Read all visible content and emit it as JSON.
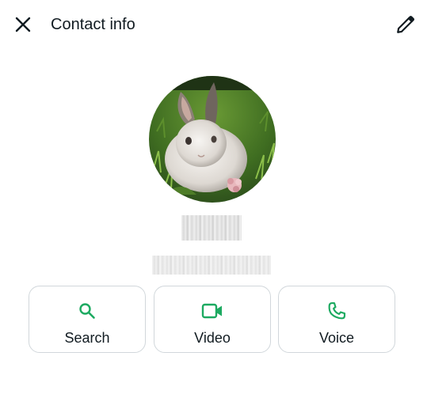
{
  "header": {
    "title": "Contact info",
    "close_icon": "close-icon",
    "edit_icon": "pencil-icon"
  },
  "profile": {
    "avatar_description_icon": "rabbit-photo",
    "name": "",
    "phone": ""
  },
  "actions": [
    {
      "label": "Search",
      "icon": "search-icon"
    },
    {
      "label": "Video",
      "icon": "video-icon"
    },
    {
      "label": "Voice",
      "icon": "phone-icon"
    }
  ],
  "colors": {
    "accent": "#1daa61",
    "text": "#111b21",
    "border": "#d1d7db"
  }
}
